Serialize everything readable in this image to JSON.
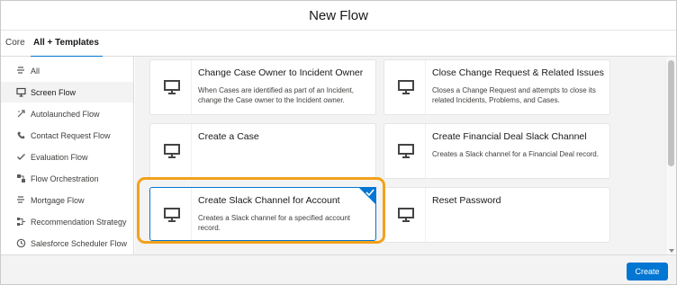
{
  "modal": {
    "title": "New Flow"
  },
  "tabs": [
    {
      "label": "Core"
    },
    {
      "label": "All + Templates",
      "active": true
    }
  ],
  "sidebar": {
    "items": [
      {
        "label": "All",
        "icon": "all-icon"
      },
      {
        "label": "Screen Flow",
        "icon": "screen-icon",
        "active": true
      },
      {
        "label": "Autolaunched Flow",
        "icon": "autolaunch-icon"
      },
      {
        "label": "Contact Request Flow",
        "icon": "contact-request-icon"
      },
      {
        "label": "Evaluation Flow",
        "icon": "evaluation-icon"
      },
      {
        "label": "Flow Orchestration",
        "icon": "orchestration-icon"
      },
      {
        "label": "Mortgage Flow",
        "icon": "mortgage-icon"
      },
      {
        "label": "Recommendation Strategy",
        "icon": "recommendation-icon"
      },
      {
        "label": "Salesforce Scheduler Flow",
        "icon": "scheduler-icon"
      }
    ]
  },
  "cards": [
    {
      "title": "Change Case Owner to Incident Owner",
      "description": "When Cases are identified as part of an Incident, change the Case owner to the Incident owner."
    },
    {
      "title": "Close Change Request & Related Issues",
      "description": "Closes a Change Request and attempts to close its related Incidents, Problems, and Cases."
    },
    {
      "title": "Create a Case",
      "description": ""
    },
    {
      "title": "Create Financial Deal Slack Channel",
      "description": "Creates a Slack channel for a Financial Deal record."
    },
    {
      "title": "Create Slack Channel for Account",
      "description": "Creates a Slack channel for a specified account record.",
      "selected": true
    },
    {
      "title": "Reset Password",
      "description": ""
    }
  ],
  "footer": {
    "create_label": "Create"
  },
  "colors": {
    "accent": "#0176d3",
    "highlight": "#f3a11b"
  }
}
